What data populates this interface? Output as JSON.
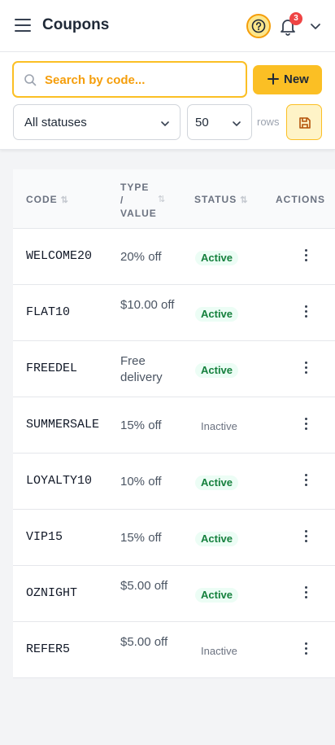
{
  "header": {
    "title": "Coupons",
    "notification_count": "3"
  },
  "toolbar": {
    "search_placeholder": "Search by code...",
    "new_label": "New",
    "status_filter": "All statuses",
    "rows_per_page": "50",
    "rows_label": "rows"
  },
  "table": {
    "headers": {
      "code": "CODE",
      "type_value_1": "TYPE",
      "type_value_2": "/",
      "type_value_3": "VALUE",
      "status": "STATUS",
      "actions": "ACTIONS"
    },
    "rows": [
      {
        "code": "WELCOME20",
        "value": "20% off",
        "status": "Active"
      },
      {
        "code": "FLAT10",
        "value": "$10.00 off",
        "status": "Active"
      },
      {
        "code": "FREEDEL",
        "value": "Free delivery",
        "status": "Active"
      },
      {
        "code": "SUMMERSALE",
        "value": "15% off",
        "status": "Inactive"
      },
      {
        "code": "LOYALTY10",
        "value": "10% off",
        "status": "Active"
      },
      {
        "code": "VIP15",
        "value": "15% off",
        "status": "Active"
      },
      {
        "code": "OZNIGHT",
        "value": "$5.00 off",
        "status": "Active"
      },
      {
        "code": "REFER5",
        "value": "$5.00 off",
        "status": "Inactive"
      }
    ]
  },
  "colors": {
    "accent": "#fbbf24",
    "active_text": "#15803d",
    "badge": "#ef4444"
  },
  "icons": [
    "menu-icon",
    "help-icon",
    "bell-icon",
    "chevron-down-icon",
    "search-icon",
    "plus-icon",
    "save-icon",
    "sort-icon",
    "kebab-icon"
  ]
}
